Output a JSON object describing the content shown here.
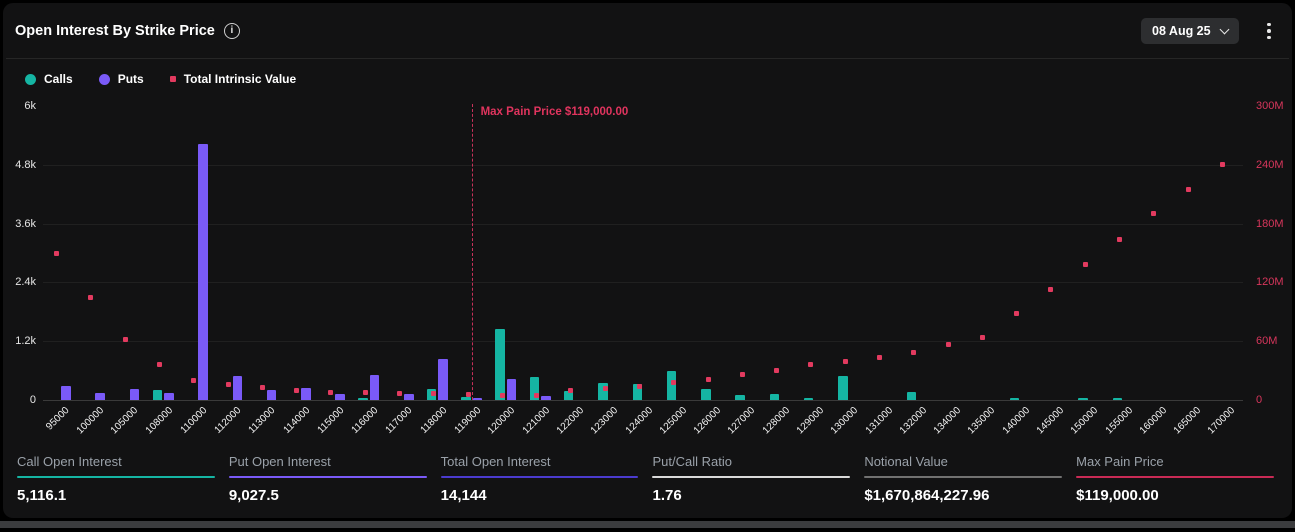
{
  "header": {
    "title": "Open Interest By Strike Price",
    "date_selector": "08 Aug 25"
  },
  "legend": [
    {
      "label": "Calls",
      "color": "#15b5a3",
      "shape": "circle"
    },
    {
      "label": "Puts",
      "color": "#7a5af8",
      "shape": "circle"
    },
    {
      "label": "Total Intrinsic Value",
      "color": "#e23a5f",
      "shape": "square"
    }
  ],
  "chart_data": {
    "type": "bar",
    "title": "Open Interest By Strike Price",
    "categories": [
      "95000",
      "100000",
      "105000",
      "108000",
      "110000",
      "112000",
      "113000",
      "114000",
      "115000",
      "116000",
      "117000",
      "118000",
      "119000",
      "120000",
      "121000",
      "122000",
      "123000",
      "124000",
      "125000",
      "126000",
      "127000",
      "128000",
      "129000",
      "130000",
      "131000",
      "132000",
      "134000",
      "135000",
      "140000",
      "145000",
      "150000",
      "155000",
      "160000",
      "165000",
      "170000"
    ],
    "series": [
      {
        "name": "Calls",
        "type": "bar",
        "axis": "left",
        "color": "#15b5a3",
        "values": [
          0,
          0,
          0,
          210,
          0,
          0,
          0,
          0,
          0,
          45,
          0,
          215,
          65,
          1450,
          460,
          180,
          350,
          330,
          600,
          225,
          100,
          115,
          40,
          480,
          0,
          155,
          0,
          0,
          25,
          0,
          25,
          25,
          0,
          0,
          0
        ]
      },
      {
        "name": "Puts",
        "type": "bar",
        "axis": "left",
        "color": "#7a5af8",
        "values": [
          290,
          135,
          230,
          135,
          5220,
          480,
          205,
          250,
          130,
          515,
          120,
          840,
          30,
          430,
          75,
          0,
          0,
          0,
          0,
          0,
          0,
          0,
          0,
          0,
          0,
          0,
          0,
          0,
          0,
          0,
          0,
          0,
          0,
          0,
          0
        ]
      },
      {
        "name": "Total Intrinsic Value",
        "type": "scatter",
        "axis": "right",
        "unit": "M",
        "color": "#e23a5f",
        "values": [
          149,
          105,
          62,
          36,
          20,
          16,
          13,
          10,
          8,
          8,
          7,
          7,
          6,
          5,
          5,
          10,
          12,
          14,
          18,
          21,
          26,
          30,
          36,
          39,
          43,
          48,
          57,
          64,
          88,
          113,
          138,
          164,
          190,
          215,
          240
        ]
      }
    ],
    "left_axis": {
      "min": 0,
      "max": 6000,
      "ticks": [
        "0",
        "1.2k",
        "2.4k",
        "3.6k",
        "4.8k",
        "6k"
      ]
    },
    "right_axis": {
      "min": 0,
      "max": 300,
      "ticks": [
        "0",
        "60M",
        "120M",
        "180M",
        "240M",
        "300M"
      ],
      "unit": "M"
    },
    "x_label_rotation": -45,
    "grid": true,
    "legend_position": "top-left",
    "max_pain": {
      "category": "119000",
      "label": "Max Pain Price $119,000.00"
    }
  },
  "stats": [
    {
      "label": "Call Open Interest",
      "value": "5,116.1",
      "underline_color": "#15b5a3"
    },
    {
      "label": "Put Open Interest",
      "value": "9,027.5",
      "underline_color": "#7a5af8"
    },
    {
      "label": "Total Open Interest",
      "value": "14,144",
      "underline_color": "#4b3bcf"
    },
    {
      "label": "Put/Call Ratio",
      "value": "1.76",
      "underline_color": "#d9d9d9"
    },
    {
      "label": "Notional Value",
      "value": "$1,670,864,227.96",
      "underline_color": "#717171"
    },
    {
      "label": "Max Pain Price",
      "value": "$119,000.00",
      "underline_color": "#c92a55"
    }
  ]
}
